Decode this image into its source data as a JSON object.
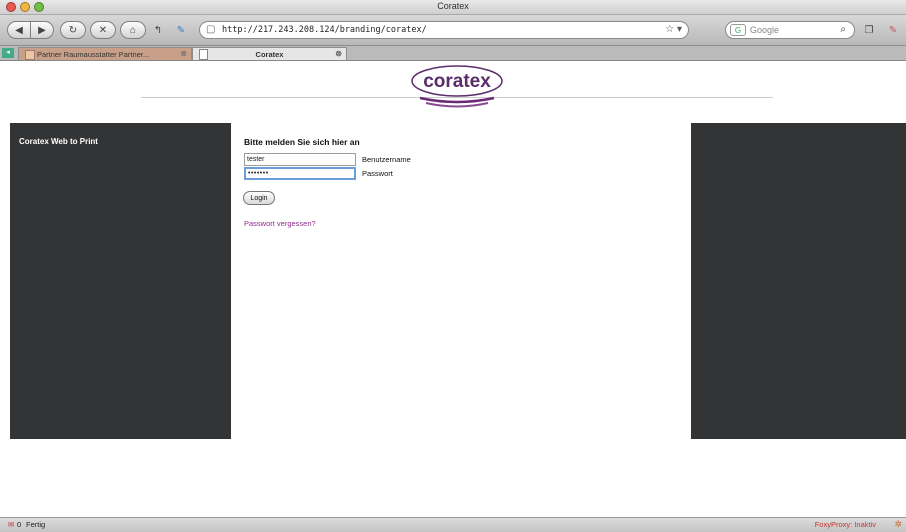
{
  "window": {
    "title": "Coratex"
  },
  "toolbar": {
    "url": "http://217.243.208.124/branding/coratex/",
    "search_placeholder": "Google"
  },
  "tabs": [
    {
      "label": "Partner Raumausstatter Partner..."
    },
    {
      "label": "Coratex"
    }
  ],
  "page": {
    "logo_text": "coratex",
    "sidebar_title": "Coratex Web to Print",
    "login_heading": "Bitte melden Sie sich hier an",
    "username_value": "tester",
    "username_label": "Benutzername",
    "password_value": "•••••••",
    "password_label": "Passwort",
    "login_button": "Login",
    "forgot_link": "Passwort vergessen?"
  },
  "status": {
    "mail_count": "0",
    "text": "Fertig",
    "proxy": "FoxyProxy: Inaktiv"
  },
  "colors": {
    "panel": "#333436",
    "link": "#8b2c8c",
    "logo_purple": "#6b2a74",
    "logo_border": "#5b2d6a"
  }
}
